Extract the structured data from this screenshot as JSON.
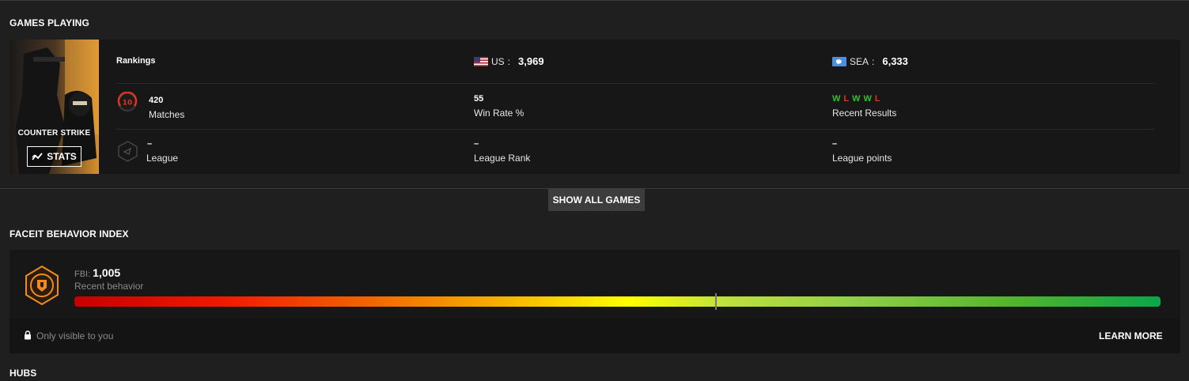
{
  "games_section": {
    "title": "GAMES PLAYING",
    "game": {
      "logo_text": "COUNTER STRIKE",
      "stats_label": "STATS",
      "rankings": {
        "label": "Rankings",
        "us": {
          "region": "US",
          "value": "3,969"
        },
        "sea": {
          "region": "SEA",
          "value": "6,333"
        }
      },
      "matches": {
        "level": "10",
        "value": "420",
        "label": "Matches"
      },
      "win_rate": {
        "value": "55",
        "label": "Win Rate %"
      },
      "recent_results": {
        "results": [
          "W",
          "L",
          "W",
          "W",
          "L"
        ],
        "label": "Recent Results"
      },
      "league": {
        "value": "–",
        "label": "League"
      },
      "league_rank": {
        "value": "–",
        "label": "League Rank"
      },
      "league_points": {
        "value": "–",
        "label": "League points"
      }
    },
    "show_all_label": "SHOW ALL GAMES"
  },
  "behavior_section": {
    "title": "FACEIT BEHAVIOR INDEX",
    "fbi_label": "FBI:",
    "fbi_value": "1,005",
    "subtitle": "Recent behavior",
    "level_fraction": 0.59,
    "privacy_text": "Only visible to you",
    "learn_more_label": "LEARN MORE"
  },
  "hubs_section": {
    "title": "HUBS"
  },
  "colors": {
    "win": "#33c12f",
    "loss": "#e0331f",
    "level_ring": "#e0331f",
    "fbi_badge": "#f08c1e"
  }
}
